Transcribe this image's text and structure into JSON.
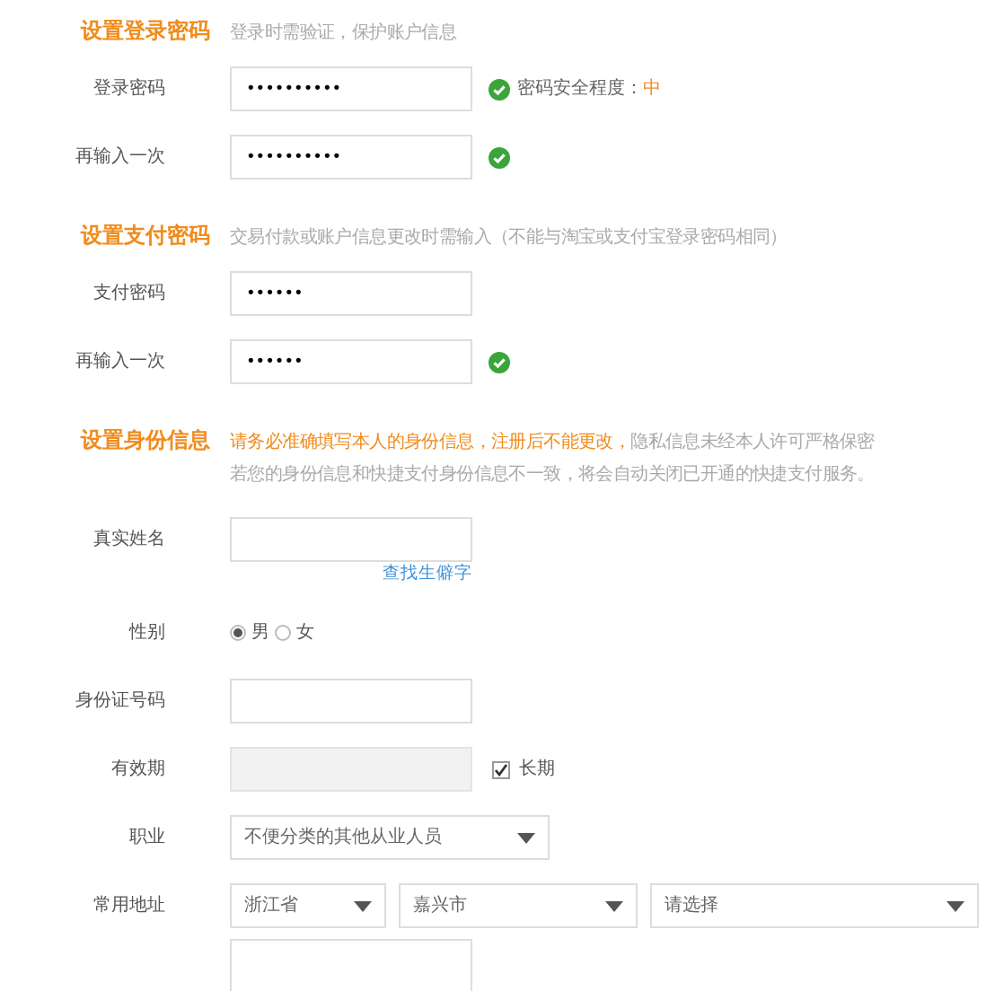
{
  "sections": [
    {
      "title": "设置登录密码",
      "hint": [
        {
          "text": "登录时需验证，保护账户信息",
          "highlight": false
        }
      ],
      "fields": [
        {
          "kind": "password",
          "label": "登录密码",
          "value": "••••••••••",
          "valid": true,
          "strength_label": "密码安全程度：",
          "strength": "中"
        },
        {
          "kind": "password",
          "label": "再输入一次",
          "value": "••••••••••",
          "valid": true
        }
      ]
    },
    {
      "title": "设置支付密码",
      "hint": [
        {
          "text": "交易付款或账户信息更改时需输入（不能与淘宝或支付宝登录密码相同）",
          "highlight": false
        }
      ],
      "fields": [
        {
          "kind": "password",
          "label": "支付密码",
          "value": "••••••",
          "valid": false
        },
        {
          "kind": "password",
          "label": "再输入一次",
          "value": "••••••",
          "valid": true
        }
      ]
    },
    {
      "title": "设置身份信息",
      "hint": [
        {
          "text": "请务必准确填写本人的身份信息，注册后不能更改，",
          "highlight": true
        },
        {
          "text": "隐私信息未经本人许可严格保密",
          "highlight": false
        }
      ],
      "hint_line_2": "若您的身份信息和快捷支付身份信息不一致，将会自动关闭已开通的快捷支付服务。",
      "fields": [
        {
          "kind": "text",
          "label": "真实姓名",
          "link": "查找生僻字"
        },
        {
          "kind": "radio",
          "label": "性别",
          "options": [
            {
              "label": "男",
              "selected": true
            },
            {
              "label": "女",
              "selected": false
            }
          ]
        },
        {
          "kind": "text",
          "label": "身份证号码"
        },
        {
          "kind": "date",
          "label": "有效期",
          "disabled": true,
          "checkbox": {
            "label": "长期",
            "checked": true
          }
        },
        {
          "kind": "select",
          "label": "职业",
          "selects": [
            {
              "value": "不便分类的其他从业人员"
            }
          ]
        },
        {
          "kind": "select",
          "label": "常用地址",
          "selects": [
            {
              "value": "浙江省"
            },
            {
              "value": "嘉兴市"
            },
            {
              "value": "请选择"
            }
          ]
        },
        {
          "kind": "textarea"
        }
      ]
    }
  ]
}
